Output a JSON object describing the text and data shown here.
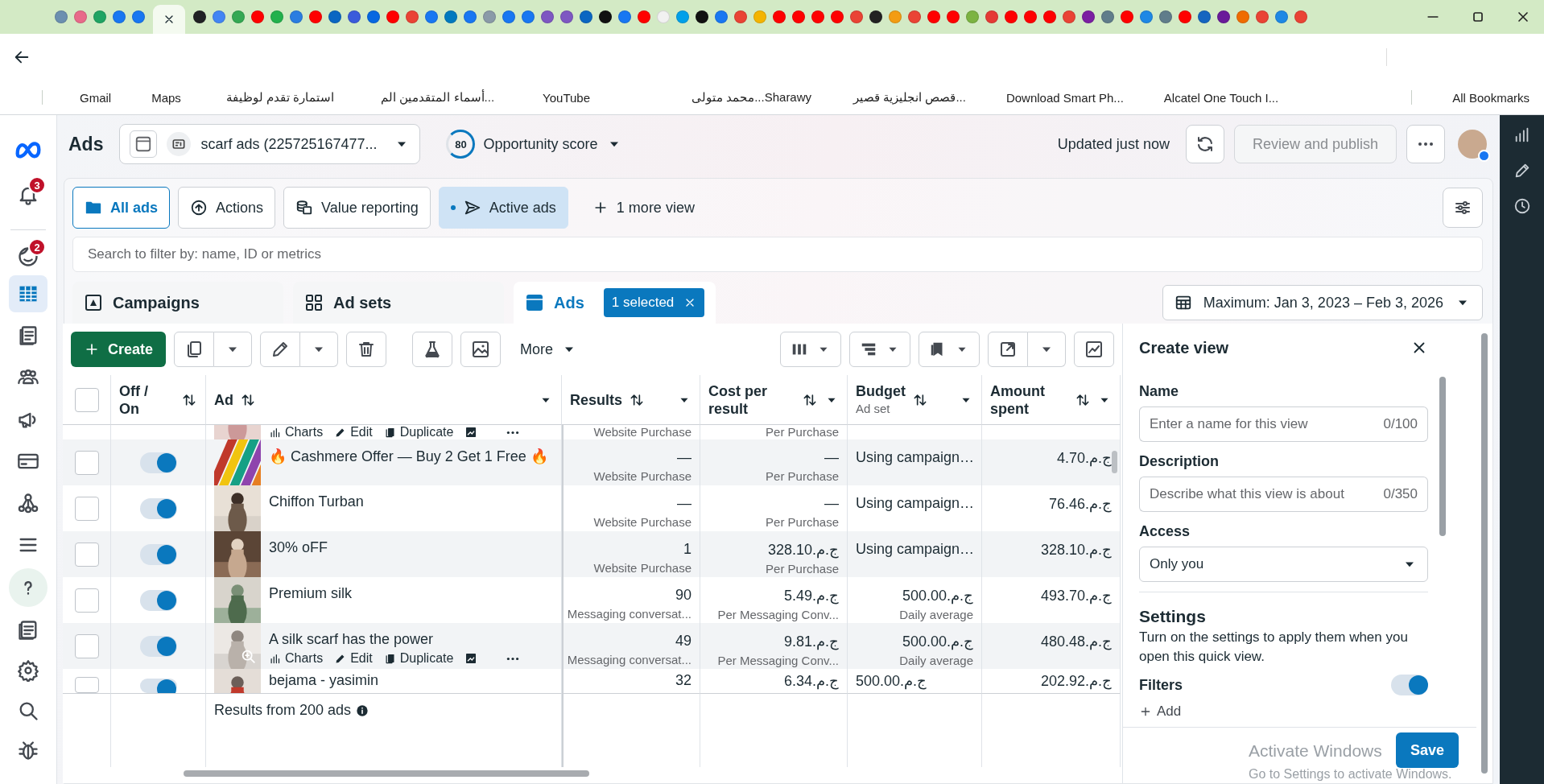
{
  "browser": {
    "tabs": [
      {
        "color": "#6b8fb0",
        "selected": false
      },
      {
        "color": "#e86a8a",
        "selected": false
      },
      {
        "color": "#1fa463",
        "selected": false
      },
      {
        "color": "#1877f2",
        "selected": false
      },
      {
        "color": "#1877f2",
        "selected": false
      },
      {
        "selected": true
      },
      {
        "color": "#202124",
        "selected": false
      },
      {
        "color": "#4285f4",
        "selected": false
      },
      {
        "color": "#34a853",
        "selected": false
      },
      {
        "color": "#ff0000",
        "selected": false
      },
      {
        "color": "#22b14c",
        "selected": false
      },
      {
        "color": "#2a7de1",
        "selected": false
      },
      {
        "color": "#ff0000",
        "selected": false
      },
      {
        "color": "#0a66c2",
        "selected": false
      },
      {
        "color": "#3b5bdb",
        "selected": false
      },
      {
        "color": "#0668e1",
        "selected": false
      },
      {
        "color": "#ff0000",
        "selected": false
      },
      {
        "color": "#ea4335",
        "selected": false
      },
      {
        "color": "#1877f2",
        "selected": false
      },
      {
        "color": "#0079bf",
        "selected": false
      },
      {
        "color": "#1877f2",
        "selected": false
      },
      {
        "color": "#8a9aa8",
        "selected": false
      },
      {
        "color": "#1877f2",
        "selected": false
      },
      {
        "color": "#1877f2",
        "selected": false
      },
      {
        "color": "#7e57c2",
        "selected": false
      },
      {
        "color": "#7e57c2",
        "selected": false
      },
      {
        "color": "#0a66c2",
        "selected": false
      },
      {
        "color": "#111111",
        "selected": false
      },
      {
        "color": "#1877f2",
        "selected": false
      },
      {
        "color": "#ff0000",
        "selected": false
      },
      {
        "color": "#f1f1f1",
        "selected": false
      },
      {
        "color": "#00a0e9",
        "selected": false
      },
      {
        "color": "#111111",
        "selected": false
      },
      {
        "color": "#1877f2",
        "selected": false
      },
      {
        "color": "#ea4335",
        "selected": false
      },
      {
        "color": "#f4b400",
        "selected": false
      },
      {
        "color": "#ff0000",
        "selected": false
      },
      {
        "color": "#ff0000",
        "selected": false
      },
      {
        "color": "#ff0000",
        "selected": false
      },
      {
        "color": "#ff0000",
        "selected": false
      },
      {
        "color": "#ea4335",
        "selected": false
      },
      {
        "color": "#222222",
        "selected": false
      },
      {
        "color": "#f39c12",
        "selected": false
      },
      {
        "color": "#ea4335",
        "selected": false
      },
      {
        "color": "#ff0000",
        "selected": false
      },
      {
        "color": "#ff0000",
        "selected": false
      },
      {
        "color": "#7cb342",
        "selected": false
      },
      {
        "color": "#e53935",
        "selected": false
      },
      {
        "color": "#ff0000",
        "selected": false
      },
      {
        "color": "#ff0000",
        "selected": false
      },
      {
        "color": "#ff0000",
        "selected": false
      },
      {
        "color": "#ea4335",
        "selected": false
      },
      {
        "color": "#7b1fa2",
        "selected": false
      },
      {
        "color": "#607d8b",
        "selected": false
      },
      {
        "color": "#ff0000",
        "selected": false
      },
      {
        "color": "#1e88e5",
        "selected": false
      },
      {
        "color": "#607d8b",
        "selected": false
      },
      {
        "color": "#ff0000",
        "selected": false
      },
      {
        "color": "#1565c0",
        "selected": false
      },
      {
        "color": "#6a1b9a",
        "selected": false
      },
      {
        "color": "#ef6c00",
        "selected": false
      },
      {
        "color": "#ea4335",
        "selected": false
      },
      {
        "color": "#1e88e5",
        "selected": false
      },
      {
        "color": "#ea4335",
        "selected": false
      }
    ],
    "bookmarks": [
      {
        "label": "Gmail"
      },
      {
        "label": "Maps"
      },
      {
        "label": "استمارة تقدم لوظيفة"
      },
      {
        "label": "أسماء المتقدمين الم..."
      },
      {
        "label": "YouTube"
      },
      {
        "label": "محمد متولى...Sharawy"
      },
      {
        "label": "قصص انجليزية قصير..."
      },
      {
        "label": "Download Smart Ph..."
      },
      {
        "label": "Alcatel One Touch I..."
      }
    ],
    "all_bookmarks": "All Bookmarks"
  },
  "nav": {
    "items": [
      {
        "kind": "logo",
        "selected": false
      },
      {
        "kind": "bell",
        "selected": false,
        "badge": "3"
      },
      {
        "kind": "face",
        "selected": false,
        "badge": "2"
      },
      {
        "kind": "table",
        "selected": true
      },
      {
        "kind": "pages",
        "selected": false
      },
      {
        "kind": "people",
        "selected": false
      },
      {
        "kind": "megaphone",
        "selected": false
      },
      {
        "kind": "card",
        "selected": false
      },
      {
        "kind": "network",
        "selected": false
      },
      {
        "kind": "menu",
        "selected": false
      },
      {
        "kind": "help",
        "selected": false
      },
      {
        "kind": "idcard",
        "selected": false
      },
      {
        "kind": "gear",
        "selected": false
      },
      {
        "kind": "search",
        "selected": false
      },
      {
        "kind": "bug",
        "selected": false
      }
    ]
  },
  "header": {
    "title": "Ads",
    "account": "scarf ads (225725167477...",
    "score": "80",
    "score_label": "Opportunity score",
    "updated": "Updated just now",
    "publish": "Review and publish",
    "publish_disabled": true
  },
  "views": [
    {
      "kind": "folder",
      "label": "All ads",
      "selected": true,
      "highlighted": false
    },
    {
      "kind": "actions",
      "label": "Actions",
      "selected": false,
      "highlighted": false
    },
    {
      "kind": "value",
      "label": "Value reporting",
      "selected": false,
      "highlighted": false
    },
    {
      "kind": "active",
      "label": "Active ads",
      "selected": false,
      "highlighted": true
    }
  ],
  "more_views": "1 more view",
  "search": {
    "placeholder": "Search to filter by: name, ID or metrics"
  },
  "levels": [
    {
      "kind": "campaigns",
      "label": "Campaigns",
      "selected": false
    },
    {
      "kind": "adsets",
      "label": "Ad sets",
      "selected": false
    },
    {
      "kind": "ads",
      "label": "Ads",
      "selected": true,
      "badge": "1 selected"
    }
  ],
  "date_range": "Maximum: Jan 3, 2023 – Feb 3, 2026",
  "toolbar": {
    "create": "Create",
    "more": "More"
  },
  "table": {
    "all_selected": false,
    "columns": [
      {
        "label": "Off / On"
      },
      {
        "label": "Ad"
      },
      {
        "label": "Results"
      },
      {
        "label": "Cost per result"
      },
      {
        "label": "Budget",
        "sublabel": "Ad set"
      },
      {
        "label": "Amount spent"
      }
    ],
    "rows": [
      {
        "kind": "tail",
        "actions": [
          "Charts",
          "Edit",
          "Duplicate"
        ],
        "results_note": "Website Purchase",
        "cost_note": "Per Purchase"
      },
      {
        "kind": "full",
        "checked": false,
        "on": true,
        "name": "🔥 Cashmere Offer — Buy 2 Get 1 Free 🔥",
        "results": "—",
        "results_note": "Website Purchase",
        "cost": "—",
        "cost_note": "Per Purchase",
        "budget": "Using campaign…",
        "spent": "ج.م.4.70"
      },
      {
        "kind": "full",
        "checked": false,
        "on": true,
        "name": "Chiffon Turban",
        "results": "—",
        "results_note": "Website Purchase",
        "cost": "—",
        "cost_note": "Per Purchase",
        "budget": "Using campaign…",
        "spent": "ج.م.76.46"
      },
      {
        "kind": "full",
        "checked": false,
        "on": true,
        "name": "30% oFF",
        "results": "1",
        "results_note": "Website Purchase",
        "cost": "ج.م.328.10",
        "cost_note": "Per Purchase",
        "budget": "Using campaign…",
        "spent": "ج.م.328.10"
      },
      {
        "kind": "full",
        "checked": false,
        "on": true,
        "name": "Premium silk",
        "results": "90",
        "results_note": "Messaging conversat...",
        "cost": "ج.م.5.49",
        "cost_note": "Per Messaging Conv...",
        "budget": "ج.م.500.00",
        "budget_note": "Daily average",
        "spent": "ج.م.493.70"
      },
      {
        "kind": "full",
        "checked": false,
        "on": true,
        "name": "A silk scarf has the power",
        "actions": [
          "Charts",
          "Edit",
          "Duplicate"
        ],
        "results": "49",
        "results_note": "Messaging conversat...",
        "cost": "ج.م.9.81",
        "cost_note": "Per Messaging Conv...",
        "budget": "ج.م.500.00",
        "budget_note": "Daily average",
        "spent": "ج.م.480.48"
      },
      {
        "kind": "head",
        "checked": false,
        "on": true,
        "name": "bejama - yasimin",
        "results": "32",
        "cost": "ج.م.6.34",
        "budget": "ج.م.500.00",
        "spent": "ج.م.202.92"
      }
    ],
    "footer": "Results from 200 ads"
  },
  "panel": {
    "title": "Create view",
    "fields": [
      {
        "label": "Name",
        "placeholder": "Enter a name for this view",
        "counter": "0/100"
      },
      {
        "label": "Description",
        "placeholder": "Describe what this view is about",
        "counter": "0/350"
      }
    ],
    "access": {
      "label": "Access",
      "value": "Only you"
    },
    "settings": {
      "title": "Settings",
      "text": "Turn on the settings to apply them when you open this quick view.",
      "filters": {
        "label": "Filters",
        "on": true
      },
      "add": "Add"
    },
    "save": "Save"
  },
  "os_notice": {
    "title": "Activate Windows",
    "text": "Go to Settings to activate Windows."
  }
}
